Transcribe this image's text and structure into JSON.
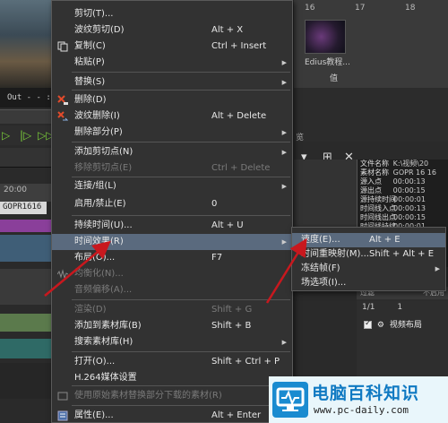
{
  "background": {
    "out_label": "Out - - : - - : - - : - -",
    "clip_name": "GOPR1616",
    "ruler_label": "20:00",
    "thumb_numbers": [
      "16",
      "17",
      "18"
    ],
    "thumb_caption": "Edius教程...",
    "value_label": "值",
    "mid_tab": "览",
    "info_panel": [
      {
        "key": "文件名称",
        "value": "K:\\视频\\20"
      },
      {
        "key": "素材名称",
        "value": "GOPR 16 16"
      },
      {
        "key": "源入点",
        "value": "00:00:13"
      },
      {
        "key": "源出点",
        "value": "00:00:15"
      },
      {
        "key": "源持续时间",
        "value": "00:00:01"
      },
      {
        "key": "时间线入点",
        "value": "00:00:13"
      },
      {
        "key": "时间线出点",
        "value": "00:00:15"
      },
      {
        "key": "时间线持续",
        "value": "00:00:01"
      }
    ],
    "layout_header": [
      "过滤",
      "不启用"
    ],
    "layout_row1": "1/1",
    "layout_row1_right": "1",
    "layout_item": "视频布局"
  },
  "menu": {
    "items": [
      {
        "label": "剪切(T)...",
        "shortcut": "",
        "disabled": false,
        "icon": ""
      },
      {
        "label": "波纹剪切(D)",
        "shortcut": "Alt + X",
        "disabled": false,
        "icon": ""
      },
      {
        "label": "复制(C)",
        "shortcut": "Ctrl + Insert",
        "disabled": false,
        "icon": "copy-icon"
      },
      {
        "label": "粘贴(P)",
        "shortcut": "",
        "disabled": false,
        "icon": "",
        "submenu": true
      },
      {
        "label": "替换(S)",
        "shortcut": "",
        "disabled": false,
        "icon": "",
        "submenu": true
      },
      {
        "label": "删除(D)",
        "shortcut": "",
        "disabled": false,
        "icon": "delete-icon"
      },
      {
        "label": "波纹删除(I)",
        "shortcut": "Alt + Delete",
        "disabled": false,
        "icon": "ripple-delete-icon"
      },
      {
        "label": "删除部分(P)",
        "shortcut": "",
        "disabled": false,
        "icon": "",
        "submenu": true
      },
      {
        "label": "添加剪切点(N)",
        "shortcut": "",
        "disabled": false,
        "icon": "",
        "submenu": true
      },
      {
        "label": "移除剪切点(E)",
        "shortcut": "Ctrl + Delete",
        "disabled": true,
        "icon": ""
      },
      {
        "label": "连接/组(L)",
        "shortcut": "",
        "disabled": false,
        "icon": "",
        "submenu": true
      },
      {
        "label": "启用/禁止(E)",
        "shortcut": "0",
        "disabled": false,
        "icon": ""
      },
      {
        "label": "持续时间(U)...",
        "shortcut": "Alt + U",
        "disabled": false,
        "icon": ""
      },
      {
        "label": "时间效果(R)",
        "shortcut": "",
        "disabled": false,
        "icon": "",
        "submenu": true,
        "highlighted": true
      },
      {
        "label": "布局(O)...",
        "shortcut": "F7",
        "disabled": false,
        "icon": ""
      },
      {
        "label": "均衡化(N)...",
        "shortcut": "",
        "disabled": true,
        "icon": "normalize-icon"
      },
      {
        "label": "音频偏移(A)...",
        "shortcut": "",
        "disabled": true,
        "icon": ""
      },
      {
        "label": "渲染(D)",
        "shortcut": "Shift + G",
        "disabled": true,
        "icon": ""
      },
      {
        "label": "添加到素材库(B)",
        "shortcut": "Shift + B",
        "disabled": false,
        "icon": ""
      },
      {
        "label": "搜索素材库(H)",
        "shortcut": "",
        "disabled": false,
        "icon": "",
        "submenu": true
      },
      {
        "label": "打开(O)...",
        "shortcut": "Shift + Ctrl + P",
        "disabled": false,
        "icon": ""
      },
      {
        "label": "H.264媒体设置",
        "shortcut": "",
        "disabled": false,
        "icon": ""
      },
      {
        "label": "使用原始素材替换部分下载的素材(R)",
        "shortcut": "",
        "disabled": true,
        "icon": "replace-icon"
      },
      {
        "label": "属性(E)...",
        "shortcut": "Alt + Enter",
        "disabled": false,
        "icon": "properties-icon"
      }
    ]
  },
  "submenu": {
    "items": [
      {
        "label": "速度(E)...",
        "shortcut": "Alt + E",
        "highlighted": true,
        "submenu": false
      },
      {
        "label": "时间重映射(M)...",
        "shortcut": "Shift + Alt + E",
        "highlighted": false,
        "submenu": false
      },
      {
        "label": "冻结帧(F)",
        "shortcut": "",
        "highlighted": false,
        "submenu": true
      },
      {
        "label": "场选项(I)...",
        "shortcut": "",
        "highlighted": false,
        "submenu": false
      }
    ]
  },
  "logo": {
    "title": "电脑百科知识",
    "url": "www.pc-daily.com"
  },
  "colors": {
    "menu_bg": "#323232",
    "highlight": "#5a6a7e",
    "arrow_red": "#c8181e",
    "logo_blue": "#0f79c2"
  }
}
